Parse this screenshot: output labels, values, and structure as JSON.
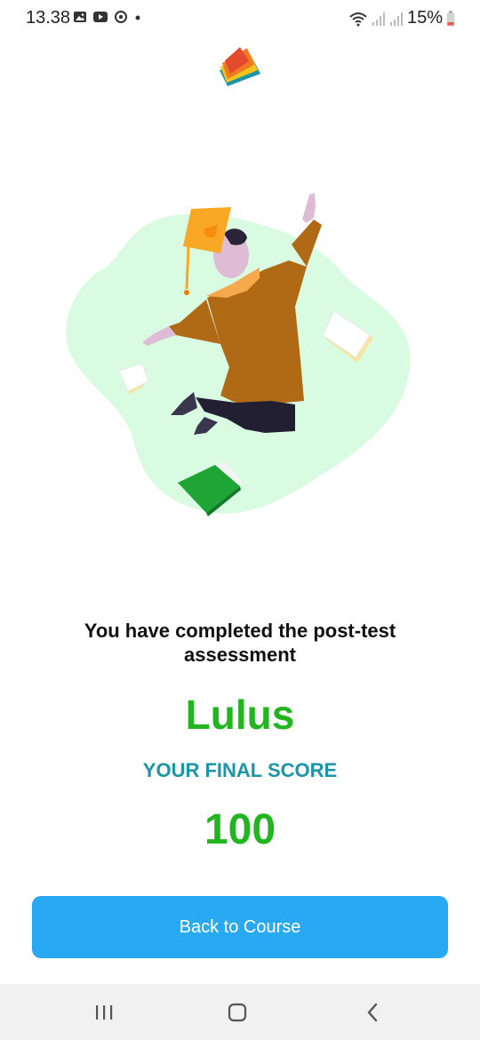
{
  "status_bar": {
    "time": "13.38",
    "battery": "15%",
    "left_icons": [
      "gallery-icon",
      "youtube-icon",
      "sync-icon",
      "dot-icon"
    ],
    "right_icons": [
      "wifi-icon",
      "signal-icon",
      "signal-icon",
      "battery-icon"
    ]
  },
  "app": {
    "logo": "books-logo"
  },
  "illustration": {
    "name": "graduate-jumping-illustration"
  },
  "result": {
    "message": "You have completed the post-test assessment",
    "status": "Lulus",
    "score_label": "YOUR FINAL SCORE",
    "score": "100"
  },
  "actions": {
    "back_label": "Back to Course"
  },
  "nav": {
    "recents": "recents-icon",
    "home": "home-icon",
    "back": "back-icon"
  },
  "colors": {
    "pass_green": "#21b520",
    "label_teal": "#1b95a8",
    "button_blue": "#29a9f2",
    "blob_mint": "#d8fbe1"
  }
}
